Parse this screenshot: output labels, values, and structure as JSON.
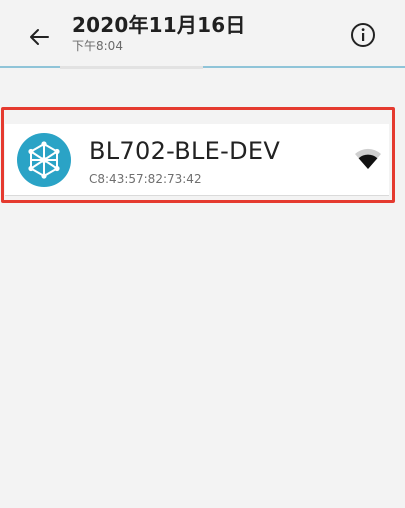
{
  "header": {
    "title": "2020年11月16日",
    "subtitle": "下午8:04",
    "back_icon": "arrow-left-icon",
    "info_icon": "info-icon"
  },
  "device": {
    "name": "BL702-BLE-DEV",
    "mac": "C8:43:57:82:73:42",
    "icon": "network-hexagon-icon",
    "signal_icon": "wifi-signal-icon"
  },
  "colors": {
    "accent": "#2aa3c6",
    "highlight": "#e53a2f",
    "background": "#f3f3f3"
  }
}
